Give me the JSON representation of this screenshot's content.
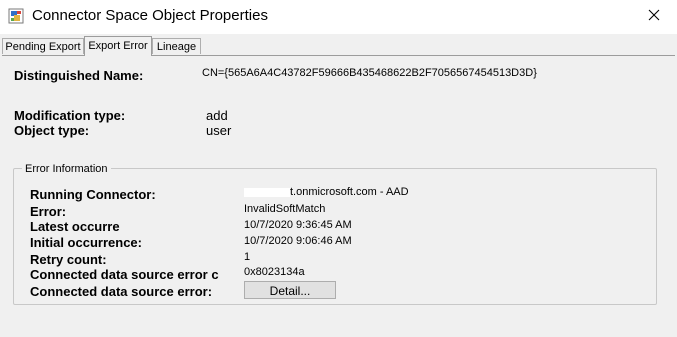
{
  "window": {
    "title": "Connector Space Object Properties",
    "app_icon": "sync-service-icon",
    "close_icon": "close-icon"
  },
  "tabs": [
    {
      "label": "Pending Export",
      "active": false
    },
    {
      "label": "Export Error",
      "active": true
    },
    {
      "label": "Lineage",
      "active": false
    }
  ],
  "object": {
    "dn_label": "Distinguished Name:",
    "dn_value": "CN={565A6A4C43782F59666B435468622B2F7056567454513D3D}",
    "mod_type_label": "Modification type:",
    "mod_type_value": "add",
    "obj_type_label": "Object type:",
    "obj_type_value": "user"
  },
  "error_info": {
    "legend": "Error Information",
    "running_connector_label": "Running Connector:",
    "running_connector_value": "t.onmicrosoft.com - AAD",
    "error_label": "Error:",
    "error_value": "InvalidSoftMatch",
    "latest_label": "Latest occurre",
    "latest_value": "10/7/2020 9:36:45 AM",
    "initial_label": "Initial occurrence:",
    "initial_value": "10/7/2020 9:06:46 AM",
    "retry_label": "Retry count:",
    "retry_value": "1",
    "cds_code_label": "Connected data source error c",
    "cds_code_value": "0x8023134a",
    "cds_error_label": "Connected data source error:",
    "detail_button": "Detail..."
  }
}
